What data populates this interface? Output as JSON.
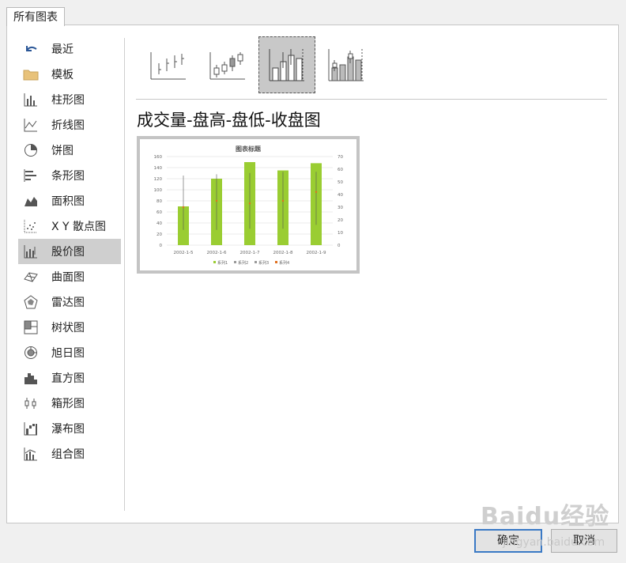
{
  "dialog": {
    "tab_label": "所有图表",
    "ok_label": "确定",
    "cancel_label": "取消"
  },
  "sidebar": {
    "items": [
      {
        "label": "最近",
        "icon": "undo-arrow-icon"
      },
      {
        "label": "模板",
        "icon": "folder-icon"
      },
      {
        "label": "柱形图",
        "icon": "column-chart-icon"
      },
      {
        "label": "折线图",
        "icon": "line-chart-icon"
      },
      {
        "label": "饼图",
        "icon": "pie-chart-icon"
      },
      {
        "label": "条形图",
        "icon": "bar-chart-icon"
      },
      {
        "label": "面积图",
        "icon": "area-chart-icon"
      },
      {
        "label": "X Y 散点图",
        "icon": "scatter-chart-icon"
      },
      {
        "label": "股价图",
        "icon": "stock-chart-icon",
        "selected": true
      },
      {
        "label": "曲面图",
        "icon": "surface-chart-icon"
      },
      {
        "label": "雷达图",
        "icon": "radar-chart-icon"
      },
      {
        "label": "树状图",
        "icon": "treemap-chart-icon"
      },
      {
        "label": "旭日图",
        "icon": "sunburst-chart-icon"
      },
      {
        "label": "直方图",
        "icon": "histogram-chart-icon"
      },
      {
        "label": "箱形图",
        "icon": "box-whisker-chart-icon"
      },
      {
        "label": "瀑布图",
        "icon": "waterfall-chart-icon"
      },
      {
        "label": "组合图",
        "icon": "combo-chart-icon"
      }
    ]
  },
  "main": {
    "subtype_selected_index": 2,
    "title": "成交量-盘高-盘低-收盘图"
  },
  "preview": {
    "chart_data": {
      "type": "bar",
      "title": "图表标题",
      "categories": [
        "2002-1-5",
        "2002-1-6",
        "2002-1-7",
        "2002-1-8",
        "2002-1-9"
      ],
      "series": [
        {
          "name": "系列1",
          "values": [
            70,
            120,
            150,
            135,
            148
          ],
          "axis": "primary",
          "color": "#9acd32"
        },
        {
          "name": "系列2",
          "values": [
            55,
            56,
            57,
            58,
            58
          ],
          "axis": "secondary"
        },
        {
          "name": "系列3",
          "values": [
            12,
            12,
            13,
            13,
            16
          ],
          "axis": "secondary"
        },
        {
          "name": "系列4",
          "values": [
            30,
            35,
            33,
            35,
            42
          ],
          "axis": "secondary",
          "color": "#e07020"
        }
      ],
      "ylim": [
        0,
        160
      ],
      "yticks": [
        0,
        20,
        40,
        60,
        80,
        100,
        120,
        140,
        160
      ],
      "y2lim": [
        0,
        70
      ],
      "y2ticks": [
        0,
        10,
        20,
        30,
        40,
        50,
        60,
        70
      ],
      "grid": true,
      "legend": "bottom"
    }
  },
  "watermark": {
    "text": "Baidu经验",
    "sub": "jingyan.baidu.com"
  }
}
